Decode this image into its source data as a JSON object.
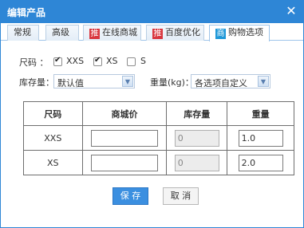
{
  "dialog": {
    "title": "编辑产品",
    "close_glyph": "✕"
  },
  "tabs": [
    {
      "label": "常规",
      "badge": "",
      "active": false
    },
    {
      "label": "高级",
      "badge": "",
      "active": false
    },
    {
      "label": "在线商城",
      "badge": "推",
      "active": false
    },
    {
      "label": "百度优化",
      "badge": "推",
      "active": false
    },
    {
      "label": "购物选项",
      "badge": "商",
      "active": true
    }
  ],
  "sizes": {
    "label": "尺码 ：",
    "options": [
      {
        "label": "XXS",
        "checked": true
      },
      {
        "label": "XS",
        "checked": true
      },
      {
        "label": "S",
        "checked": false
      }
    ]
  },
  "stock": {
    "label": "库存量：",
    "value": "默认值"
  },
  "weight": {
    "label": "重量(kg)：",
    "value": "各选项自定义"
  },
  "table": {
    "headers": [
      "尺码",
      "商城价",
      "库存量",
      "重量"
    ],
    "rows": [
      {
        "size": "XXS",
        "price": "",
        "stock": "0",
        "weight": "1.0"
      },
      {
        "size": "XS",
        "price": "",
        "stock": "0",
        "weight": "2.0"
      }
    ]
  },
  "buttons": {
    "save": "保 存",
    "cancel": "取 消"
  },
  "colors": {
    "titlebar": "#2e86d6",
    "badge_red": "#d9363e",
    "badge_blue": "#1f98d8",
    "primary_button": "#3b8fe0"
  },
  "icons": {
    "close": "close-icon",
    "select_arrow": "chevron-down-icon",
    "checkbox": "checkbox-icon"
  }
}
